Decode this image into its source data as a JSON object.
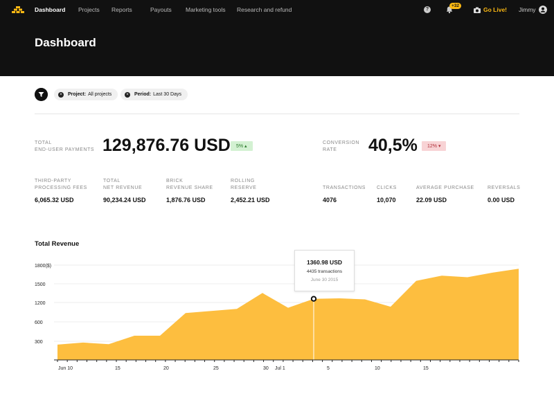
{
  "nav": {
    "items": [
      {
        "label": "Dashboard",
        "active": true
      },
      {
        "label": "Projects"
      },
      {
        "label": "Reports"
      },
      {
        "label": "Payouts"
      },
      {
        "label": "Marketing tools"
      },
      {
        "label": "Research and refund"
      }
    ],
    "help_icon": "question-icon",
    "notifications_badge": "+32",
    "go_live_label": "Go Live!",
    "user_name": "Jimmy"
  },
  "header": {
    "title": "Dashboard"
  },
  "filters": {
    "filter_icon": "filter-icon",
    "chips": [
      {
        "key": "Project:",
        "value": "All projects"
      },
      {
        "key": "Period:",
        "value": "Last 30 Days"
      }
    ]
  },
  "kpis": {
    "total_payments": {
      "label_1": "TOTAL",
      "label_2": "END-USER PAYMENTS",
      "value": "129,876.76 USD",
      "change": "5% ▴",
      "trend": "up"
    },
    "conversion": {
      "label_1": "CONVERSION",
      "label_2": "RATE",
      "value": "40,5%",
      "change": "12% ▾",
      "trend": "down"
    },
    "left_metrics": [
      {
        "label_1": "THIRD-PARTY",
        "label_2": "PROCESSING FEES",
        "value": "6,065.32 USD"
      },
      {
        "label_1": "TOTAL",
        "label_2": "NET REVENUE",
        "value": "90,234.24 USD"
      },
      {
        "label_1": "BRICK",
        "label_2": "REVENUE SHARE",
        "value": "1,876.76 USD"
      },
      {
        "label_1": "ROLLING",
        "label_2": "RESERVE",
        "value": "2,452.21 USD"
      }
    ],
    "right_metrics": [
      {
        "label": "TRANSACTIONS",
        "value": "4076"
      },
      {
        "label": "CLICKS",
        "value": "10,070"
      },
      {
        "label": "AVERAGE PURCHASE",
        "value": "22.09 USD"
      },
      {
        "label": "REVERSALS",
        "value": "0.00 USD"
      }
    ]
  },
  "chart_data": {
    "type": "area",
    "title": "Total Revenue",
    "y_ticks": [
      "1800($)",
      "1500",
      "1200",
      "600",
      "300"
    ],
    "x_ticks": [
      "Jun 10",
      "15",
      "20",
      "25",
      "30",
      "Jul 1",
      "5",
      "10",
      "15"
    ],
    "ylim": [
      0,
      1800
    ],
    "values": [
      290,
      330,
      300,
      460,
      460,
      890,
      930,
      970,
      1270,
      990,
      1160,
      1170,
      1150,
      1010,
      1500,
      1600,
      1570,
      1660,
      1730
    ],
    "color": "#fdbe3f",
    "highlight": {
      "index": 10,
      "value": "1360.98 USD",
      "transactions": "4435 transactions",
      "date": "June 30 2015"
    }
  }
}
